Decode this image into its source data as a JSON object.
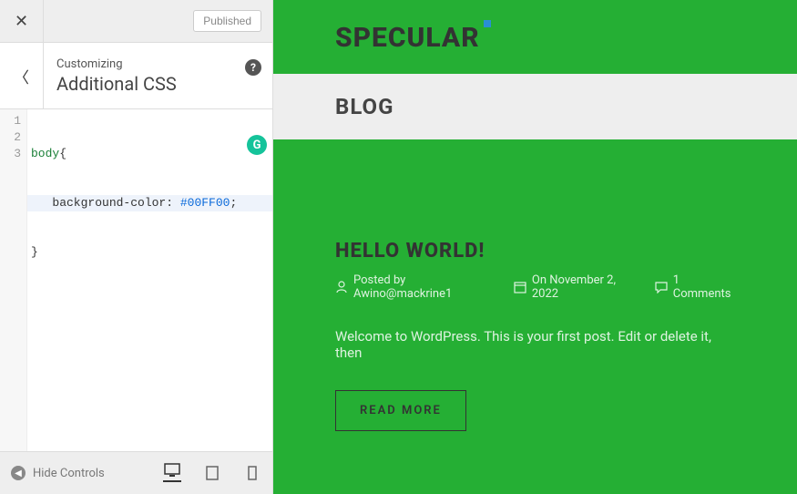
{
  "customizer": {
    "published_label": "Published",
    "section_label": "Customizing",
    "section_title": "Additional CSS",
    "hide_controls_label": "Hide Controls",
    "code": {
      "line1_selector": "body",
      "line1_brace": "{",
      "line2_indent": "   ",
      "line2_prop": "background-color",
      "line2_colon": ": ",
      "line2_val": "#00FF00",
      "line2_semi": ";",
      "line3": "}",
      "gutter": [
        "1",
        "2",
        "3"
      ]
    }
  },
  "preview": {
    "site_logo": "SPECULAR",
    "nav_blog": "BLOG",
    "post": {
      "title": "HELLO WORLD!",
      "author_prefix": "Posted by ",
      "author": "Awino@mackrine1",
      "date_prefix": "On ",
      "date": "November 2, 2022",
      "comments": "1 Comments",
      "excerpt": "Welcome to WordPress. This is your first post. Edit or delete it, then",
      "read_more": "READ MORE"
    }
  },
  "grammarly_label": "G"
}
